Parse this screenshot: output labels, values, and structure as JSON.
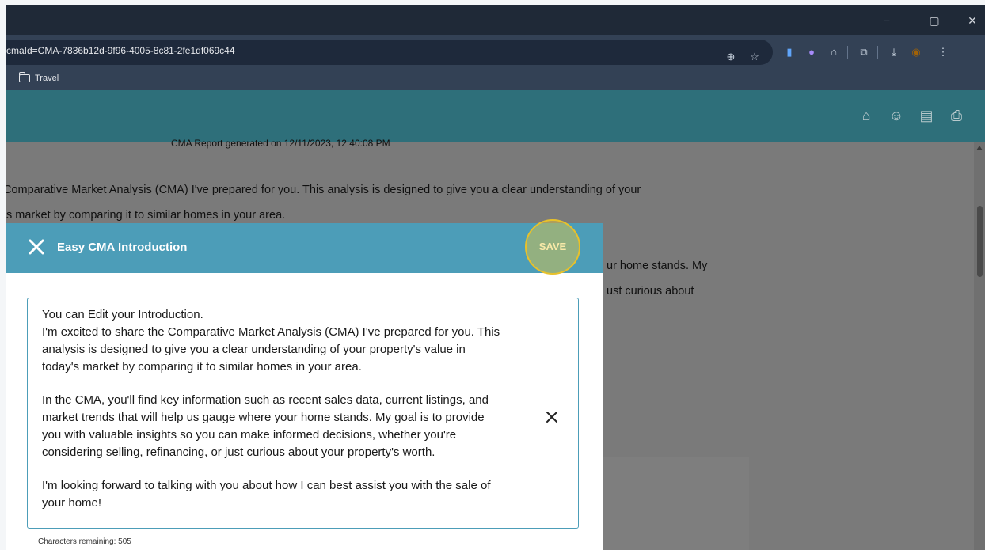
{
  "window": {
    "minimize": "−",
    "maximize": "▢",
    "close": "✕"
  },
  "browser": {
    "url": "cmaId=CMA-7836b12d-9f96-4005-8c81-2fe1df069c44",
    "icons": [
      "zoom-icon",
      "star-icon",
      "extension-blue-icon",
      "extension-purple-icon",
      "extensions-puzzle-icon",
      "screenshot-icon",
      "download-icon",
      "profile-avatar",
      "menu-kebab-icon"
    ]
  },
  "bookmarks": {
    "items": [
      {
        "label": "Travel"
      }
    ]
  },
  "page": {
    "report_generated": "CMA Report generated on 12/11/2023, 12:40:08 PM",
    "line1": "Comparative Market Analysis (CMA) I've prepared for you. This analysis is designed to give you a clear understanding of your",
    "line2": "s market by comparing it to similar homes in your area.",
    "line3": "ur home stands. My",
    "line4": "ust curious about"
  },
  "modal": {
    "title": "Easy CMA Introduction",
    "save_label": "SAVE",
    "paragraph1_line1": "You can Edit your Introduction.",
    "paragraph1_line2": "I'm excited to share the Comparative Market Analysis (CMA) I've prepared for you. This",
    "paragraph1_line3": "analysis is designed to give you a clear understanding of your property's value in",
    "paragraph1_line4": "today's market by comparing it to similar homes in your area.",
    "paragraph2_line1": "In the CMA, you'll find key information such as recent sales data, current listings, and",
    "paragraph2_line2": "market trends that will help us gauge where your home stands. My goal is to provide",
    "paragraph2_line3": "you with valuable insights so you can make informed decisions, whether you're",
    "paragraph2_line4": "considering selling, refinancing, or just curious about your property's worth.",
    "paragraph3_line1": "I'm looking forward to talking with you about how I can best assist you with the sale of",
    "paragraph3_line2": "your home!",
    "characters_remaining": "Characters remaining: 505"
  },
  "colors": {
    "header_teal": "#2e6f7a",
    "modal_header": "#4c9db8",
    "save_highlight": "#e8c12a"
  }
}
